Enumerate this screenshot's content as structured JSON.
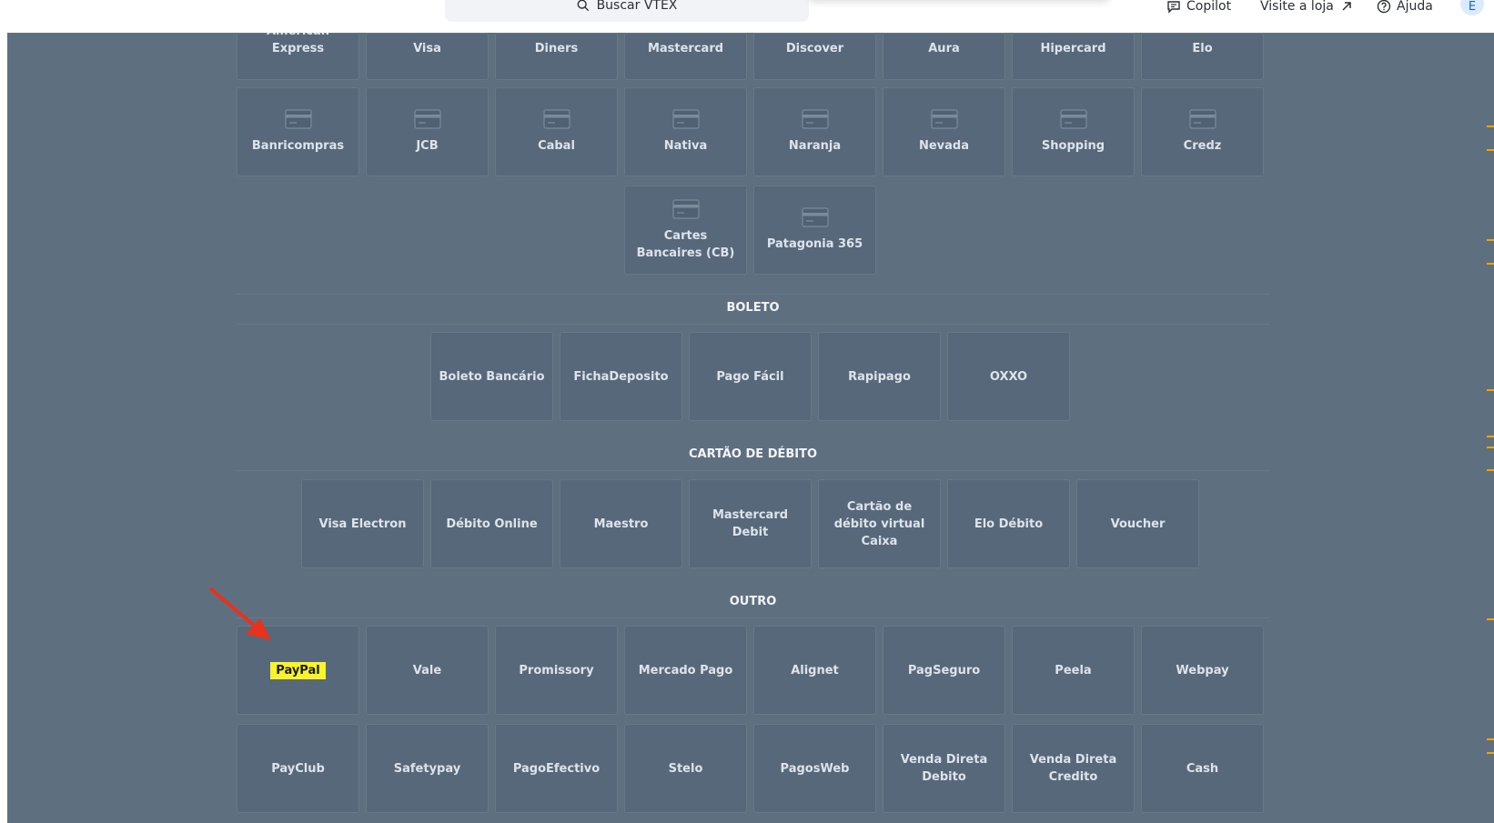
{
  "header": {
    "search_placeholder": "Buscar VTEX",
    "copilot_label": "Copilot",
    "visit_store_label": "Visite a loja",
    "help_label": "Ajuda",
    "avatar_initial": "E"
  },
  "credit_cards_row1": [
    "American Express",
    "Visa",
    "Diners",
    "Mastercard",
    "Discover",
    "Aura",
    "Hipercard",
    "Elo"
  ],
  "credit_cards_row2": [
    "Banricompras",
    "JCB",
    "Cabal",
    "Nativa",
    "Naranja",
    "Nevada",
    "Shopping",
    "Credz"
  ],
  "credit_cards_row3": [
    "Cartes Bancaires (CB)",
    "Patagonia 365"
  ],
  "boleto": {
    "title": "BOLETO",
    "items": [
      "Boleto Bancário",
      "FichaDeposito",
      "Pago Fácil",
      "Rapipago",
      "OXXO"
    ]
  },
  "debit": {
    "title": "CARTÃO DE DÉBITO",
    "items": [
      "Visa Electron",
      "Débito Online",
      "Maestro",
      "Mastercard Debit",
      "Cartão de débito virtual Caixa",
      "Elo Débito",
      "Voucher"
    ]
  },
  "other": {
    "title": "OUTRO",
    "row1": [
      "PayPal",
      "Vale",
      "Promissory",
      "Mercado Pago",
      "Alignet",
      "PagSeguro",
      "Peela",
      "Webpay"
    ],
    "row2": [
      "PayClub",
      "Safetypay",
      "PagoEfectivo",
      "Stelo",
      "PagosWeb",
      "Venda Direta Debito",
      "Venda Direta Credito",
      "Cash"
    ]
  },
  "colors": {
    "background": "#5e6f80",
    "card": "#56687a",
    "highlight": "#f8f32b",
    "annotation_arrow": "#e8321e",
    "scroll_ticks": "#f0a500"
  },
  "icons": [
    "search-icon",
    "copilot-icon",
    "external-link-icon",
    "help-icon",
    "credit-card-icon",
    "arrow-annotation-icon"
  ]
}
